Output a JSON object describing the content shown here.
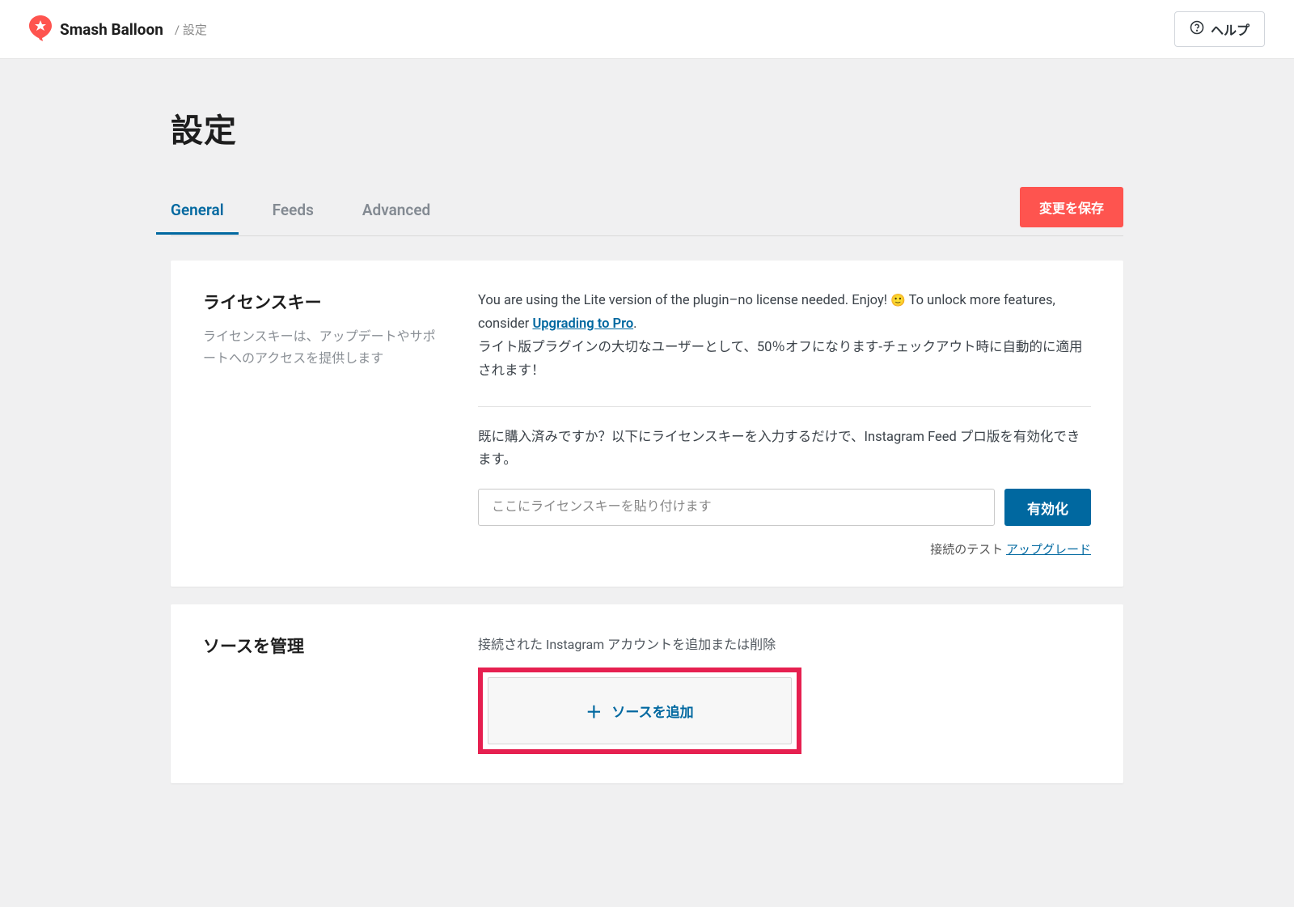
{
  "header": {
    "brand": "Smash Balloon",
    "breadcrumb": "/ 設定",
    "help_label": "ヘルプ"
  },
  "page": {
    "title": "設定"
  },
  "tabs": {
    "general": "General",
    "feeds": "Feeds",
    "advanced": "Advanced"
  },
  "actions": {
    "save": "変更を保存"
  },
  "license": {
    "title": "ライセンスキー",
    "desc": "ライセンスキーは、アップデートやサポートへのアクセスを提供します",
    "lite_text_1": "You are using the Lite version of the plugin–no license needed. Enjoy! ",
    "lite_text_2": " To unlock more features, consider ",
    "upgrade_link": "Upgrading to Pro",
    "lite_text_3": ".",
    "discount_text": "ライト版プラグインの大切なユーザーとして、50％オフになります-チェックアウト時に自動的に適用されます！",
    "already_purchased": "既に購入済みですか？以下にライセンスキーを入力するだけで、Instagram Feed プロ版を有効化できます。",
    "placeholder": "ここにライセンスキーを貼り付けます",
    "activate_btn": "有効化",
    "test_connection": "接続のテスト",
    "upgrade_small": "アップグレード"
  },
  "sources": {
    "title": "ソースを管理",
    "desc": "接続された Instagram アカウントを追加または削除",
    "add_label": "ソースを追加"
  }
}
